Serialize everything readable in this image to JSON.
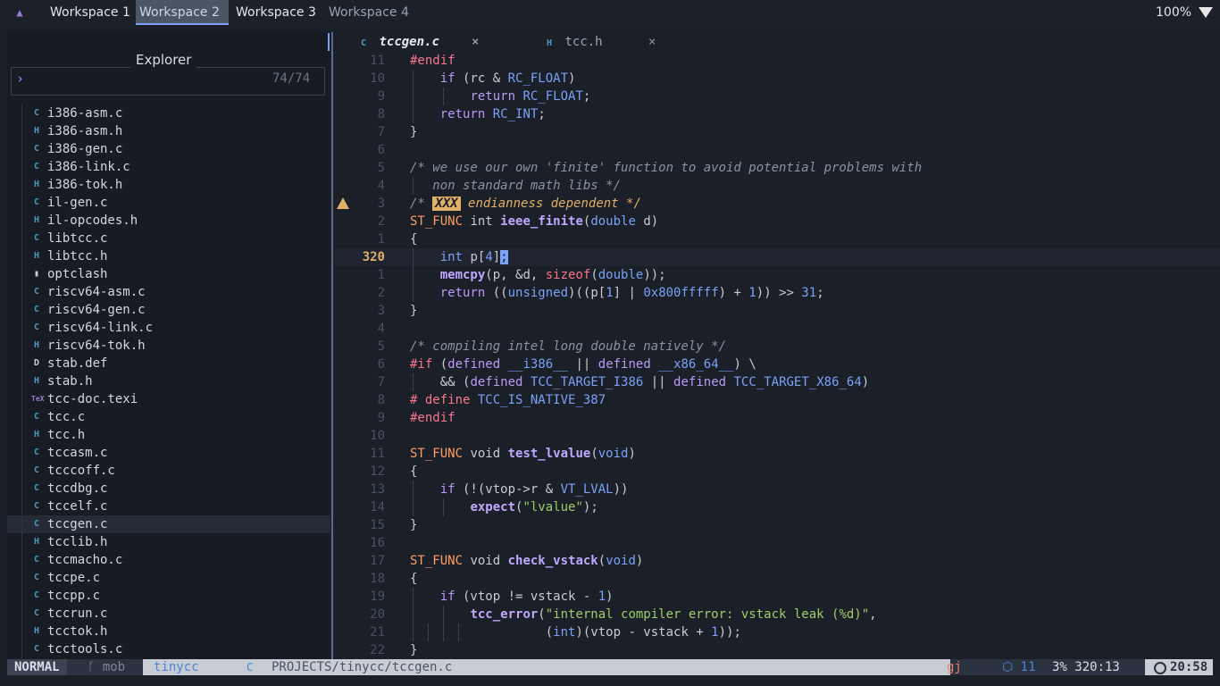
{
  "topbar": {
    "workspaces": [
      "Workspace 1",
      "Workspace 2",
      "Workspace 3",
      "Workspace 4"
    ],
    "active_workspace": "Workspace 2",
    "zoom": "100%",
    "icons": [
      "app-logo-icon",
      "wifi-icon"
    ]
  },
  "explorer": {
    "title": "Explorer",
    "search_prompt": "›",
    "count": "74/74",
    "selected": "tccgen.c",
    "files": [
      {
        "name": "i386-asm.c",
        "icon": "C"
      },
      {
        "name": "i386-asm.h",
        "icon": "H"
      },
      {
        "name": "i386-gen.c",
        "icon": "C"
      },
      {
        "name": "i386-link.c",
        "icon": "C"
      },
      {
        "name": "i386-tok.h",
        "icon": "H"
      },
      {
        "name": "il-gen.c",
        "icon": "C"
      },
      {
        "name": "il-opcodes.h",
        "icon": "H"
      },
      {
        "name": "libtcc.c",
        "icon": "C"
      },
      {
        "name": "libtcc.h",
        "icon": "H"
      },
      {
        "name": "optclash",
        "icon": "▮"
      },
      {
        "name": "riscv64-asm.c",
        "icon": "C"
      },
      {
        "name": "riscv64-gen.c",
        "icon": "C"
      },
      {
        "name": "riscv64-link.c",
        "icon": "C"
      },
      {
        "name": "riscv64-tok.h",
        "icon": "H"
      },
      {
        "name": "stab.def",
        "icon": "D"
      },
      {
        "name": "stab.h",
        "icon": "H"
      },
      {
        "name": "tcc-doc.texi",
        "icon": "TeX"
      },
      {
        "name": "tcc.c",
        "icon": "C"
      },
      {
        "name": "tcc.h",
        "icon": "H"
      },
      {
        "name": "tccasm.c",
        "icon": "C"
      },
      {
        "name": "tcccoff.c",
        "icon": "C"
      },
      {
        "name": "tccdbg.c",
        "icon": "C"
      },
      {
        "name": "tccelf.c",
        "icon": "C"
      },
      {
        "name": "tccgen.c",
        "icon": "C"
      },
      {
        "name": "tcclib.h",
        "icon": "H"
      },
      {
        "name": "tccmacho.c",
        "icon": "C"
      },
      {
        "name": "tccpe.c",
        "icon": "C"
      },
      {
        "name": "tccpp.c",
        "icon": "C"
      },
      {
        "name": "tccrun.c",
        "icon": "C"
      },
      {
        "name": "tcctok.h",
        "icon": "H"
      },
      {
        "name": "tcctools.c",
        "icon": "C"
      }
    ]
  },
  "tabs": [
    {
      "label": "tccgen.c",
      "icon": "C",
      "close": "×",
      "active": true
    },
    {
      "label": "tcc.h",
      "icon": "H",
      "close": "×",
      "active": false
    }
  ],
  "editor": {
    "current_line": "320",
    "lines": [
      {
        "n": "11",
        "html": "<span class=\"pp\">#endif</span>"
      },
      {
        "n": "10",
        "guides": 1,
        "html": "    <span class=\"kw\">if</span> (rc &amp; <span class=\"cst\">RC_FLOAT</span>)"
      },
      {
        "n": "9",
        "guides": 2,
        "html": "        <span class=\"kw\">return</span> <span class=\"cst\">RC_FLOAT</span>;"
      },
      {
        "n": "8",
        "guides": 1,
        "html": "    <span class=\"kw\">return</span> <span class=\"cst\">RC_INT</span>;"
      },
      {
        "n": "7",
        "html": "}"
      },
      {
        "n": "6",
        "html": ""
      },
      {
        "n": "5",
        "html": "<span class=\"cm\">/* we use our own 'finite' function to avoid potential problems with</span>"
      },
      {
        "n": "4",
        "guides": 1,
        "html": "<span class=\"cm\">   non standard math libs */</span>"
      },
      {
        "n": "3",
        "warn": true,
        "html": "<span class=\"cm\">/* </span><span class=\"todo\">XXX</span><span class=\"cm\"> </span><span class=\"cm\" style=\"color:#e0af68\">endianness dependent */</span>"
      },
      {
        "n": "2",
        "html": "<span class=\"mac\">ST_FUNC</span> int <span class=\"fn\">ieee_finite</span>(<span class=\"ty\">double</span> d)"
      },
      {
        "n": "1",
        "html": "{"
      },
      {
        "n": "320",
        "cur": true,
        "guides": 1,
        "html": "    <span class=\"ty\">int</span> p[<span class=\"num\">4</span>]<span class=\"cursor\">;</span>"
      },
      {
        "n": "1",
        "guides": 1,
        "html": "    <span class=\"fn\">memcpy</span>(p, &amp;d, <span class=\"pp\">sizeof</span>(<span class=\"ty\">double</span>));"
      },
      {
        "n": "2",
        "guides": 1,
        "html": "    <span class=\"kw\">return</span> ((<span class=\"ty\">unsigned</span>)((p[<span class=\"num\">1</span>] | <span class=\"num\">0x800fffff</span>) + <span class=\"num\">1</span>)) &gt;&gt; <span class=\"num\">31</span>;"
      },
      {
        "n": "3",
        "html": "}"
      },
      {
        "n": "4",
        "html": ""
      },
      {
        "n": "5",
        "html": "<span class=\"cm\">/* compiling intel long double natively */</span>"
      },
      {
        "n": "6",
        "html": "<span class=\"pp\">#if</span> (<span class=\"kw\">defined</span> <span class=\"cst\">__i386__</span> || <span class=\"kw\">defined</span> <span class=\"cst\">__x86_64__</span>) \\"
      },
      {
        "n": "7",
        "guides": 1,
        "html": "    &amp;&amp; (<span class=\"kw\">defined</span> <span class=\"cst\">TCC_TARGET_I386</span> || <span class=\"kw\">defined</span> <span class=\"cst\">TCC_TARGET_X86_64</span>)"
      },
      {
        "n": "8",
        "html": "<span class=\"pp\"># define</span> <span class=\"cst\">TCC_IS_NATIVE_387</span>"
      },
      {
        "n": "9",
        "html": "<span class=\"pp\">#endif</span>"
      },
      {
        "n": "10",
        "html": ""
      },
      {
        "n": "11",
        "html": "<span class=\"mac\">ST_FUNC</span> void <span class=\"fn\">test_lvalue</span>(<span class=\"ty\">void</span>)"
      },
      {
        "n": "12",
        "html": "{"
      },
      {
        "n": "13",
        "guides": 1,
        "html": "    <span class=\"kw\">if</span> (!(vtop-&gt;r &amp; <span class=\"cst\">VT_LVAL</span>))"
      },
      {
        "n": "14",
        "guides": 2,
        "html": "        <span class=\"fn\">expect</span>(<span class=\"str\">\"lvalue\"</span>);"
      },
      {
        "n": "15",
        "html": "}"
      },
      {
        "n": "16",
        "html": ""
      },
      {
        "n": "17",
        "html": "<span class=\"mac\">ST_FUNC</span> void <span class=\"fn\">check_vstack</span>(<span class=\"ty\">void</span>)"
      },
      {
        "n": "18",
        "html": "{"
      },
      {
        "n": "19",
        "guides": 1,
        "html": "    <span class=\"kw\">if</span> (vtop != vstack - <span class=\"num\">1</span>)"
      },
      {
        "n": "20",
        "guides": 2,
        "html": "        <span class=\"fn\">tcc_error</span>(<span class=\"str\">\"internal compiler error: vstack leak (%d)\"</span>,"
      },
      {
        "n": "21",
        "guides": 4,
        "html": "                  (<span class=\"ty\">int</span>)(vtop - vstack + <span class=\"num\">1</span>));"
      },
      {
        "n": "22",
        "html": "}"
      }
    ]
  },
  "statusline": {
    "mode": "NORMAL",
    "branch": "ᚴ mob",
    "project": "tinycc",
    "lang_icon": "C",
    "file": "PROJECTS/tinycc/tccgen.c",
    "warn": "gj",
    "lsp": "⬡ 11",
    "position": "3% 320:13",
    "clock": "20:58"
  }
}
